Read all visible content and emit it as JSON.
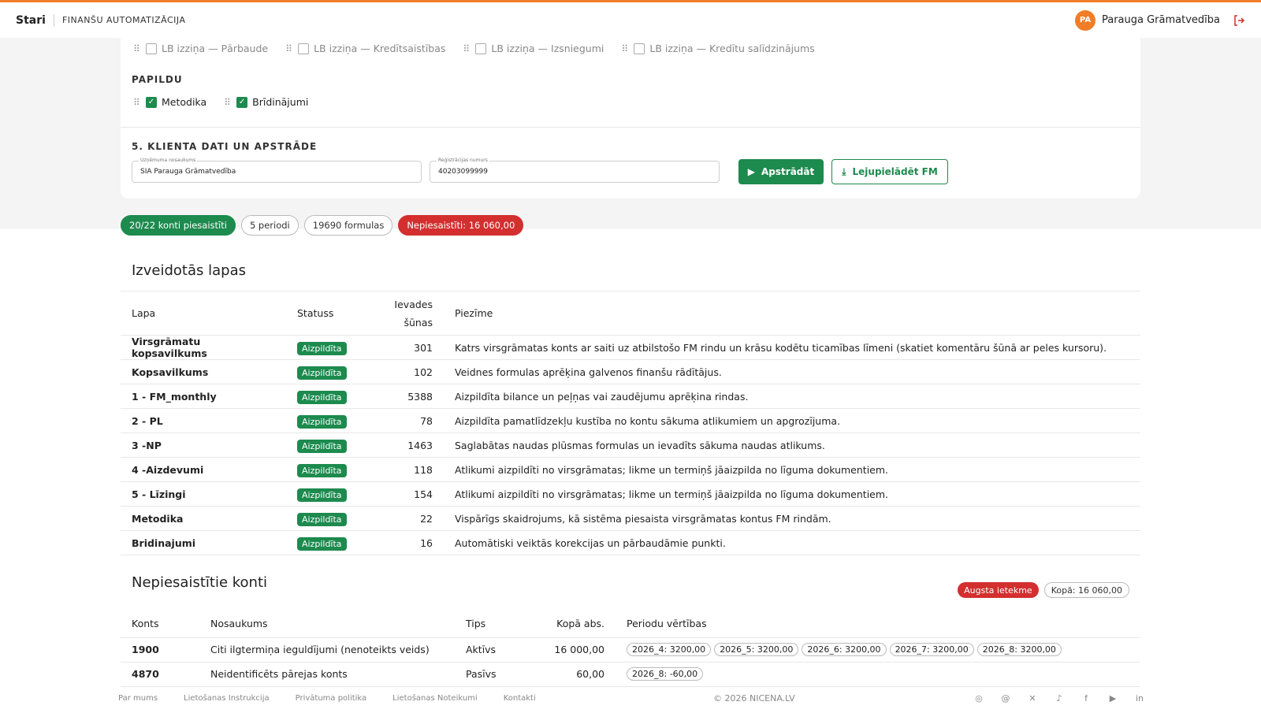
{
  "header": {
    "brand": "Stari",
    "subtitle": "FINANŠU AUTOMATIZĀCIJA",
    "avatar_initials": "PA",
    "user_name": "Parauga Grāmatvedība",
    "accent_color": "#f07d27"
  },
  "reports": {
    "items": [
      {
        "label": "LB izziņa — Pārbaude",
        "checked": false
      },
      {
        "label": "LB izziņa — Kredītsaistības",
        "checked": false
      },
      {
        "label": "LB izziņa — Izsniegumi",
        "checked": false
      },
      {
        "label": "LB izziņa — Kredītu salīdzinājums",
        "checked": false
      }
    ]
  },
  "extra": {
    "title": "PAPILDU",
    "items": [
      {
        "label": "Metodika",
        "checked": true
      },
      {
        "label": "Brīdinājumi",
        "checked": true
      }
    ]
  },
  "client": {
    "title": "5. KLIENTA DATI UN APSTRĀDE",
    "company_label": "Uzņēmuma nosaukums",
    "company_value": "SIA Parauga Grāmatvedība",
    "reg_label": "Reģistrācijas numurs",
    "reg_value": "40203099999",
    "process_button": "Apstrādāt",
    "download_button": "Lejupielādēt FM"
  },
  "summary": {
    "linked": "20/22 konti piesaistīti",
    "periods": "5 periodi",
    "formulas": "19690 formulas",
    "unlinked": "Nepiesaistīti: 16 060,00"
  },
  "sheets": {
    "title": "Izveidotās lapas",
    "columns": {
      "sheet": "Lapa",
      "status": "Statuss",
      "inputs_1": "Ievades",
      "inputs_2": "šūnas",
      "note": "Piezīme"
    },
    "rows": [
      {
        "sheet": "Virsgrāmatu kopsavilkums",
        "status": "Aizpildīta",
        "inputs": "301",
        "note": "Katrs virsgrāmatas konts ar saiti uz atbilstošo FM rindu un krāsu kodētu ticamības līmeni (skatiet komentāru šūnā ar peles kursoru)."
      },
      {
        "sheet": "Kopsavilkums",
        "status": "Aizpildīta",
        "inputs": "102",
        "note": "Veidnes formulas aprēķina galvenos finanšu rādītājus."
      },
      {
        "sheet": "1 - FM_monthly",
        "status": "Aizpildīta",
        "inputs": "5388",
        "note": "Aizpildīta bilance un peļņas vai zaudējumu aprēķina rindas."
      },
      {
        "sheet": "2 - PL",
        "status": "Aizpildīta",
        "inputs": "78",
        "note": "Aizpildīta pamatlīdzekļu kustība no kontu sākuma atlikumiem un apgrozījuma."
      },
      {
        "sheet": "3 -NP",
        "status": "Aizpildīta",
        "inputs": "1463",
        "note": "Saglabātas naudas plūsmas formulas un ievadīts sākuma naudas atlikums."
      },
      {
        "sheet": "4 -Aizdevumi",
        "status": "Aizpildīta",
        "inputs": "118",
        "note": "Atlikumi aizpildīti no virsgrāmatas; likme un termiņš jāaizpilda no līguma dokumentiem."
      },
      {
        "sheet": "5 - Līzingi",
        "status": "Aizpildīta",
        "inputs": "154",
        "note": "Atlikumi aizpildīti no virsgrāmatas; likme un termiņš jāaizpilda no līguma dokumentiem."
      },
      {
        "sheet": "Metodika",
        "status": "Aizpildīta",
        "inputs": "22",
        "note": "Vispārīgs skaidrojums, kā sistēma piesaista virsgrāmatas kontus FM rindām."
      },
      {
        "sheet": "Bridinajumi",
        "status": "Aizpildīta",
        "inputs": "16",
        "note": "Automātiski veiktās korekcijas un pārbaudāmie punkti."
      }
    ]
  },
  "unlinked": {
    "title": "Nepiesaistītie konti",
    "impact_badge": "Augsta ietekme",
    "total_badge": "Kopā: 16 060,00",
    "columns": {
      "account": "Konts",
      "name": "Nosaukums",
      "type": "Tips",
      "total": "Kopā abs.",
      "periods": "Periodu vērtības"
    },
    "rows": [
      {
        "account": "1900",
        "name": "Citi ilgtermiņa ieguldījumi (nenoteikts veids)",
        "type": "Aktīvs",
        "total": "16 000,00",
        "periods": [
          "2026_4: 3200,00",
          "2026_5: 3200,00",
          "2026_6: 3200,00",
          "2026_7: 3200,00",
          "2026_8: 3200,00"
        ]
      },
      {
        "account": "4870",
        "name": "Neidentificēts pārejas konts",
        "type": "Pasīvs",
        "total": "60,00",
        "periods": [
          "2026_8: -60,00"
        ]
      }
    ]
  },
  "footer": {
    "links": [
      "Par mums",
      "Lietošanas Instrukcija",
      "Privātuma politika",
      "Lietošanas Noteikumi",
      "Kontakti"
    ],
    "copyright": "© 2026 NICENA.LV",
    "social_icons": [
      "instagram-icon",
      "threads-icon",
      "x-icon",
      "tiktok-icon",
      "facebook-icon",
      "youtube-icon",
      "linkedin-icon"
    ]
  },
  "colors": {
    "primary_green": "#1d8a4e",
    "danger_red": "#d32f2f"
  }
}
